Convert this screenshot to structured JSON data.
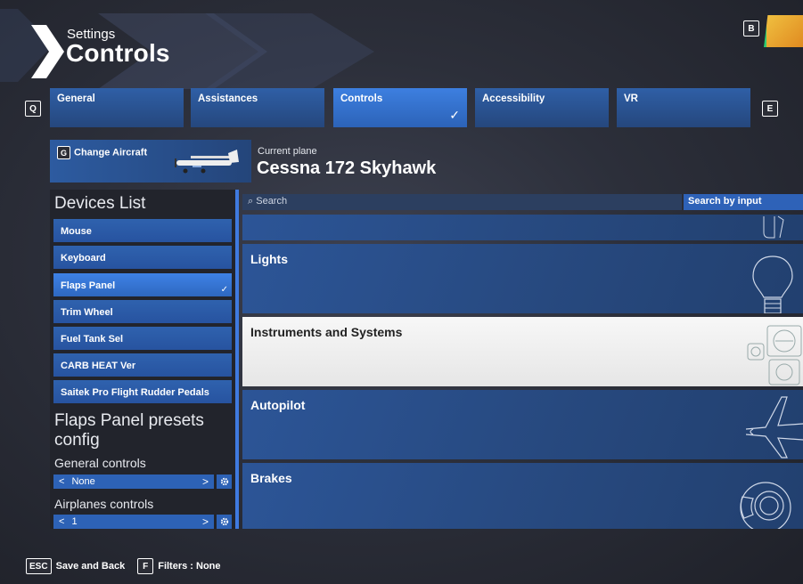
{
  "header": {
    "breadcrumb": "Settings",
    "title": "Controls",
    "profile_key": "B"
  },
  "tabs": {
    "prev_key": "Q",
    "next_key": "E",
    "items": [
      {
        "label": "General",
        "active": false
      },
      {
        "label": "Assistances",
        "active": false
      },
      {
        "label": "Controls",
        "active": true
      },
      {
        "label": "Accessibility",
        "active": false
      },
      {
        "label": "VR",
        "active": false
      }
    ]
  },
  "aircraft": {
    "change_key": "G",
    "change_label": "Change Aircraft",
    "current_label": "Current plane",
    "current_name": "Cessna 172 Skyhawk"
  },
  "devices": {
    "title": "Devices List",
    "items": [
      {
        "label": "Mouse",
        "active": false
      },
      {
        "label": "Keyboard",
        "active": false
      },
      {
        "label": "Flaps Panel",
        "active": true
      },
      {
        "label": "Trim Wheel",
        "active": false
      },
      {
        "label": "Fuel Tank Sel",
        "active": false
      },
      {
        "label": "CARB HEAT Ver",
        "active": false
      },
      {
        "label": "Saitek Pro Flight Rudder Pedals",
        "active": false
      }
    ]
  },
  "presets": {
    "title": "Flaps Panel presets config",
    "general_label": "General controls",
    "general_value": "None",
    "airplanes_label": "Airplanes controls",
    "airplanes_value": "1"
  },
  "search": {
    "placeholder": "Search",
    "by_input_label": "Search by input"
  },
  "categories": [
    {
      "label": "",
      "icon": "partial-icon"
    },
    {
      "label": "Lights",
      "icon": "lightbulb-icon"
    },
    {
      "label": "Instruments and Systems",
      "icon": "instruments-icon",
      "selected": true
    },
    {
      "label": "Autopilot",
      "icon": "airplane-icon"
    },
    {
      "label": "Brakes",
      "icon": "brake-disc-icon"
    }
  ],
  "footer": {
    "back_key": "ESC",
    "back_label": "Save and Back",
    "filter_key": "F",
    "filter_label": "Filters : None"
  }
}
